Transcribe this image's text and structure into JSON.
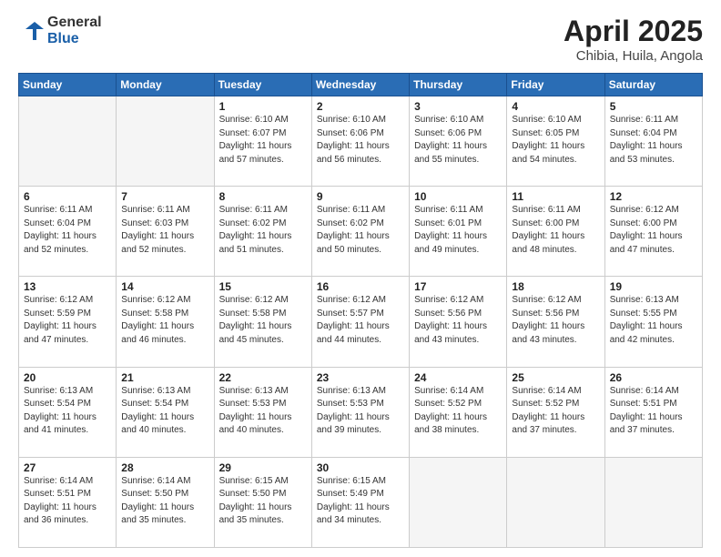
{
  "header": {
    "logo_general": "General",
    "logo_blue": "Blue",
    "title": "April 2025",
    "subtitle": "Chibia, Huila, Angola"
  },
  "calendar": {
    "days_of_week": [
      "Sunday",
      "Monday",
      "Tuesday",
      "Wednesday",
      "Thursday",
      "Friday",
      "Saturday"
    ],
    "weeks": [
      [
        {
          "day": "",
          "info": ""
        },
        {
          "day": "",
          "info": ""
        },
        {
          "day": "1",
          "info": "Sunrise: 6:10 AM\nSunset: 6:07 PM\nDaylight: 11 hours and 57 minutes."
        },
        {
          "day": "2",
          "info": "Sunrise: 6:10 AM\nSunset: 6:06 PM\nDaylight: 11 hours and 56 minutes."
        },
        {
          "day": "3",
          "info": "Sunrise: 6:10 AM\nSunset: 6:06 PM\nDaylight: 11 hours and 55 minutes."
        },
        {
          "day": "4",
          "info": "Sunrise: 6:10 AM\nSunset: 6:05 PM\nDaylight: 11 hours and 54 minutes."
        },
        {
          "day": "5",
          "info": "Sunrise: 6:11 AM\nSunset: 6:04 PM\nDaylight: 11 hours and 53 minutes."
        }
      ],
      [
        {
          "day": "6",
          "info": "Sunrise: 6:11 AM\nSunset: 6:04 PM\nDaylight: 11 hours and 52 minutes."
        },
        {
          "day": "7",
          "info": "Sunrise: 6:11 AM\nSunset: 6:03 PM\nDaylight: 11 hours and 52 minutes."
        },
        {
          "day": "8",
          "info": "Sunrise: 6:11 AM\nSunset: 6:02 PM\nDaylight: 11 hours and 51 minutes."
        },
        {
          "day": "9",
          "info": "Sunrise: 6:11 AM\nSunset: 6:02 PM\nDaylight: 11 hours and 50 minutes."
        },
        {
          "day": "10",
          "info": "Sunrise: 6:11 AM\nSunset: 6:01 PM\nDaylight: 11 hours and 49 minutes."
        },
        {
          "day": "11",
          "info": "Sunrise: 6:11 AM\nSunset: 6:00 PM\nDaylight: 11 hours and 48 minutes."
        },
        {
          "day": "12",
          "info": "Sunrise: 6:12 AM\nSunset: 6:00 PM\nDaylight: 11 hours and 47 minutes."
        }
      ],
      [
        {
          "day": "13",
          "info": "Sunrise: 6:12 AM\nSunset: 5:59 PM\nDaylight: 11 hours and 47 minutes."
        },
        {
          "day": "14",
          "info": "Sunrise: 6:12 AM\nSunset: 5:58 PM\nDaylight: 11 hours and 46 minutes."
        },
        {
          "day": "15",
          "info": "Sunrise: 6:12 AM\nSunset: 5:58 PM\nDaylight: 11 hours and 45 minutes."
        },
        {
          "day": "16",
          "info": "Sunrise: 6:12 AM\nSunset: 5:57 PM\nDaylight: 11 hours and 44 minutes."
        },
        {
          "day": "17",
          "info": "Sunrise: 6:12 AM\nSunset: 5:56 PM\nDaylight: 11 hours and 43 minutes."
        },
        {
          "day": "18",
          "info": "Sunrise: 6:12 AM\nSunset: 5:56 PM\nDaylight: 11 hours and 43 minutes."
        },
        {
          "day": "19",
          "info": "Sunrise: 6:13 AM\nSunset: 5:55 PM\nDaylight: 11 hours and 42 minutes."
        }
      ],
      [
        {
          "day": "20",
          "info": "Sunrise: 6:13 AM\nSunset: 5:54 PM\nDaylight: 11 hours and 41 minutes."
        },
        {
          "day": "21",
          "info": "Sunrise: 6:13 AM\nSunset: 5:54 PM\nDaylight: 11 hours and 40 minutes."
        },
        {
          "day": "22",
          "info": "Sunrise: 6:13 AM\nSunset: 5:53 PM\nDaylight: 11 hours and 40 minutes."
        },
        {
          "day": "23",
          "info": "Sunrise: 6:13 AM\nSunset: 5:53 PM\nDaylight: 11 hours and 39 minutes."
        },
        {
          "day": "24",
          "info": "Sunrise: 6:14 AM\nSunset: 5:52 PM\nDaylight: 11 hours and 38 minutes."
        },
        {
          "day": "25",
          "info": "Sunrise: 6:14 AM\nSunset: 5:52 PM\nDaylight: 11 hours and 37 minutes."
        },
        {
          "day": "26",
          "info": "Sunrise: 6:14 AM\nSunset: 5:51 PM\nDaylight: 11 hours and 37 minutes."
        }
      ],
      [
        {
          "day": "27",
          "info": "Sunrise: 6:14 AM\nSunset: 5:51 PM\nDaylight: 11 hours and 36 minutes."
        },
        {
          "day": "28",
          "info": "Sunrise: 6:14 AM\nSunset: 5:50 PM\nDaylight: 11 hours and 35 minutes."
        },
        {
          "day": "29",
          "info": "Sunrise: 6:15 AM\nSunset: 5:50 PM\nDaylight: 11 hours and 35 minutes."
        },
        {
          "day": "30",
          "info": "Sunrise: 6:15 AM\nSunset: 5:49 PM\nDaylight: 11 hours and 34 minutes."
        },
        {
          "day": "",
          "info": ""
        },
        {
          "day": "",
          "info": ""
        },
        {
          "day": "",
          "info": ""
        }
      ]
    ]
  }
}
